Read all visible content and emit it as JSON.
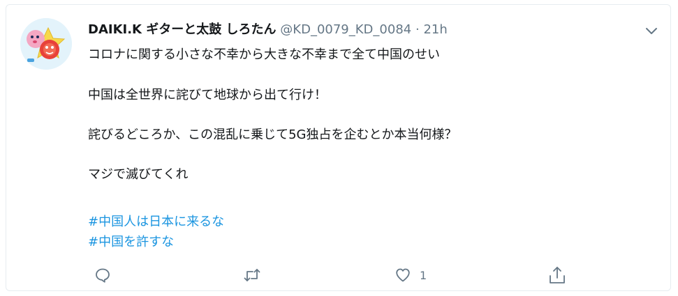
{
  "user": {
    "display_name": "DAIKI.K ギターと太鼓 しろたん",
    "handle": "@KD_0079_KD_0084",
    "separator": "·",
    "timestamp": "21h"
  },
  "tweet": {
    "paragraphs": [
      "コロナに関する小さな不幸から大きな不幸まで全て中国のせい",
      "中国は全世界に詫びて地球から出て行け！",
      "詫びるどころか、この混乱に乗じて5G独占を企むとか本当何様？",
      "マジで滅びてくれ"
    ],
    "hashtags": [
      "#中国人は日本に来るな",
      "#中国を許すな"
    ]
  },
  "actions": {
    "reply_icon": "reply-icon",
    "retweet_icon": "retweet-icon",
    "like_icon": "heart-icon",
    "like_count": "1",
    "share_icon": "share-icon"
  },
  "colors": {
    "text": "#14171a",
    "secondary": "#657786",
    "link": "#1b95e0",
    "border": "#e6ecf0"
  }
}
